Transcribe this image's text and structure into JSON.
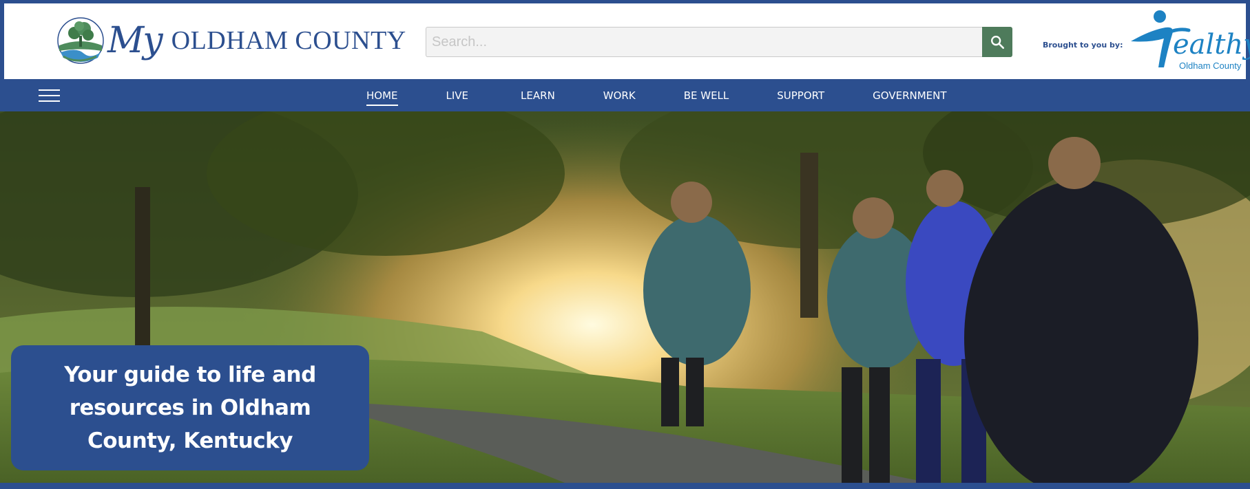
{
  "header": {
    "logo": {
      "my": "My",
      "name": "OLDHAM COUNTY",
      "icon": "tree-river-icon"
    },
    "search": {
      "placeholder": "Search...",
      "value": "",
      "icon": "search-icon"
    },
    "brought_by": "Brought to you by:",
    "partner_logo": {
      "word": "ealthy",
      "sub": "Oldham County"
    }
  },
  "nav": {
    "menu_icon": "hamburger-icon",
    "items": [
      {
        "label": "HOME",
        "active": true
      },
      {
        "label": "LIVE",
        "active": false
      },
      {
        "label": "LEARN",
        "active": false
      },
      {
        "label": "WORK",
        "active": false
      },
      {
        "label": "BE WELL",
        "active": false
      },
      {
        "label": "SUPPORT",
        "active": false
      },
      {
        "label": "GOVERNMENT",
        "active": false
      }
    ]
  },
  "hero": {
    "tagline": "Your guide to life and resources in Oldham County, Kentucky"
  },
  "colors": {
    "brand_blue": "#2c4f8f",
    "search_green": "#4e7b5b",
    "partner_blue": "#1d82c3"
  }
}
